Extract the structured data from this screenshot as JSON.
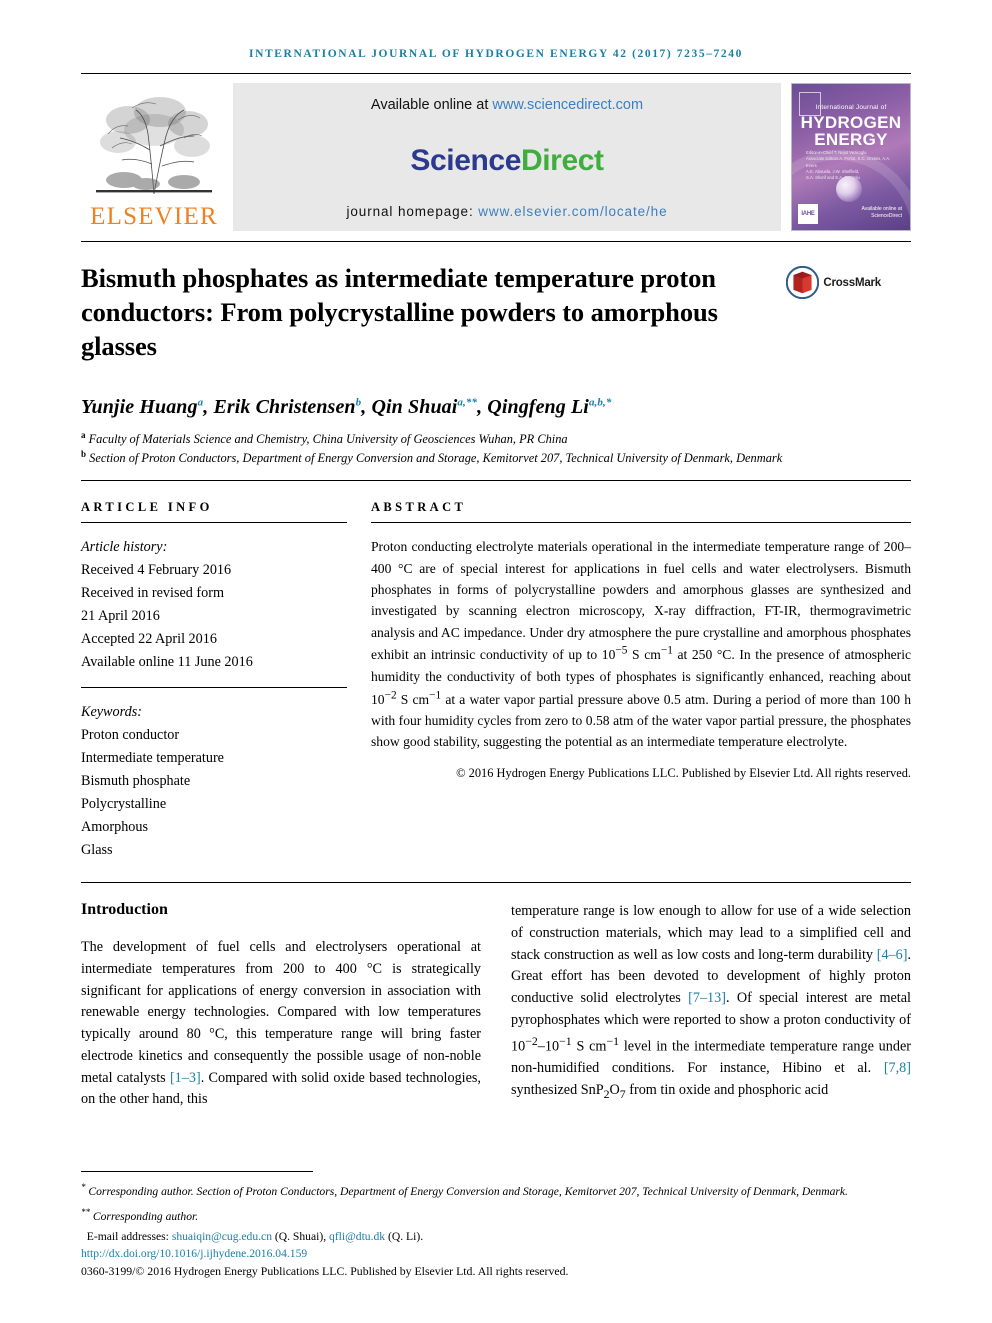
{
  "running_head": "International Journal of Hydrogen Energy 42 (2017) 7235–7240",
  "masthead": {
    "publisher": "ELSEVIER",
    "available_prefix": "Available online at ",
    "available_url": "www.sciencedirect.com",
    "brand_part1": "Science",
    "brand_part2": "Direct",
    "homepage_label": "journal homepage: ",
    "homepage_url": "www.elsevier.com/locate/he",
    "cover": {
      "top_label": "International Journal of",
      "line1": "HYDROGEN",
      "line2": "ENERGY",
      "editor_lines": "Editor-in-Chief  T. Nejat Veziroglu\nAssociate Editors  A. Perlot, K.C. Gretsis, A.A. Evers\nA.E. Abouela, J.W. Sheffield,\nS.A. Sherif and E.A. Sengolu",
      "bottom_mark": "IAHE",
      "sciencedirect_mark": "Available online at\nScienceDirect"
    }
  },
  "article": {
    "title": "Bismuth phosphates as intermediate temperature proton conductors: From polycrystalline powders to amorphous glasses",
    "crossmark_label": "CrossMark",
    "authors": [
      {
        "name": "Yunjie Huang",
        "sup": "a"
      },
      {
        "name": "Erik Christensen",
        "sup": "b"
      },
      {
        "name": "Qin Shuai",
        "sup": "a,**"
      },
      {
        "name": "Qingfeng Li",
        "sup": "a,b,*"
      }
    ],
    "affiliations": [
      {
        "marker": "a",
        "text": "Faculty of Materials Science and Chemistry, China University of Geosciences Wuhan, PR China"
      },
      {
        "marker": "b",
        "text": "Section of Proton Conductors, Department of Energy Conversion and Storage, Kemitorvet 207, Technical University of Denmark, Denmark"
      }
    ]
  },
  "article_info": {
    "heading": "ARTICLE INFO",
    "history_label": "Article history:",
    "history": [
      "Received 4 February 2016",
      "Received in revised form",
      "21 April 2016",
      "Accepted 22 April 2016",
      "Available online 11 June 2016"
    ],
    "keywords_label": "Keywords:",
    "keywords": [
      "Proton conductor",
      "Intermediate temperature",
      "Bismuth phosphate",
      "Polycrystalline",
      "Amorphous",
      "Glass"
    ]
  },
  "abstract": {
    "heading": "ABSTRACT",
    "copyright": "© 2016 Hydrogen Energy Publications LLC. Published by Elsevier Ltd. All rights reserved."
  },
  "body": {
    "intro_heading": "Introduction",
    "copyright_year": "2016"
  },
  "footnotes": {
    "corresponding_1_symbol": "*",
    "corresponding_1": "Corresponding author. Section of Proton Conductors, Department of Energy Conversion and Storage, Kemitorvet 207, Technical University of Denmark, Denmark.",
    "corresponding_2_symbol": "**",
    "corresponding_2": "Corresponding author.",
    "email_label": "E-mail addresses:",
    "email_1": "shuaiqin@cug.edu.cn",
    "email_1_owner": "(Q. Shuai)",
    "email_2": "qfli@dtu.dk",
    "email_2_owner": "(Q. Li).",
    "doi": "http://dx.doi.org/10.1016/j.ijhydene.2016.04.159",
    "issn_line": "0360-3199/© 2016 Hydrogen Energy Publications LLC. Published by Elsevier Ltd. All rights reserved."
  },
  "colors": {
    "link_blue": "#1a7fa8",
    "elsevier_orange": "#f08020",
    "sciencedirect_green": "#3fae3f",
    "sciencedirect_navy": "#2b3a8f"
  }
}
